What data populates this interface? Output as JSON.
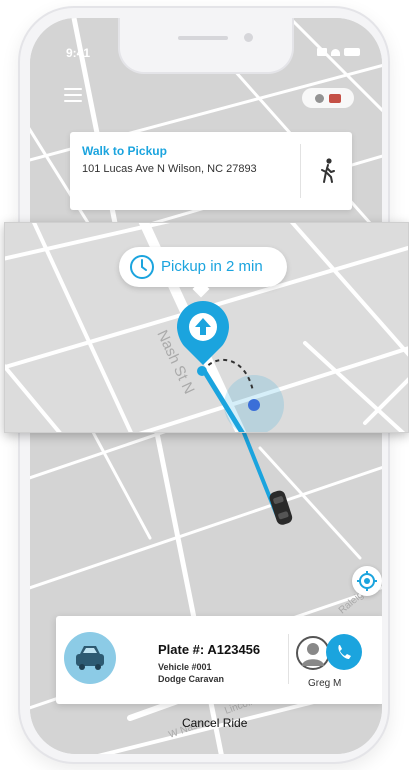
{
  "status_bar": {
    "time": "9:41"
  },
  "walk_card": {
    "title": "Walk to Pickup",
    "address": "101 Lucas Ave N Wilson, NC 27893",
    "icon": "walking-person-icon"
  },
  "pickup_bubble": {
    "label": "Pickup in 2 min",
    "icon": "clock-icon"
  },
  "map": {
    "street_label": "Nash St N",
    "street_labels_lower": [
      "Raleigh R",
      "W Nash",
      "Lincoln College Dr W"
    ]
  },
  "vehicle_card": {
    "plate": "Plate #: A123456",
    "vehicle_number": "Vehicle #001",
    "model": "Dodge Caravan",
    "driver_name": "Greg M",
    "call_icon": "phone-icon"
  },
  "cancel_label": "Cancel Ride",
  "colors": {
    "accent": "#1ba4de",
    "map_bg": "#d4d4d4",
    "road": "#ffffff"
  }
}
